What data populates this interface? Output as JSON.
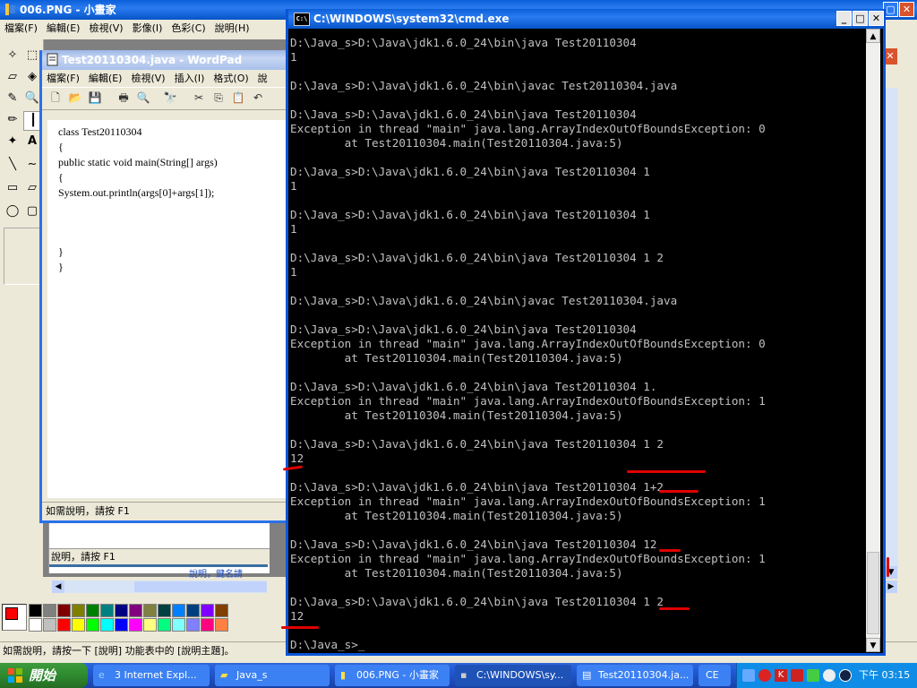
{
  "paint": {
    "title": "006.PNG - 小畫家",
    "menu": [
      "檔案(F)",
      "編輯(E)",
      "檢視(V)",
      "影像(I)",
      "色彩(C)",
      "說明(H)"
    ],
    "status": "如需說明，請按一下 [說明] 功能表中的 [說明主題]。",
    "palette_colors": [
      "#000000",
      "#808080",
      "#800000",
      "#808000",
      "#008000",
      "#008080",
      "#000080",
      "#800080",
      "#808040",
      "#004040",
      "#0080ff",
      "#004080",
      "#8000ff",
      "#804000",
      "#ffffff",
      "#c0c0c0",
      "#ff0000",
      "#ffff00",
      "#00ff00",
      "#00ffff",
      "#0000ff",
      "#ff00ff",
      "#ffff80",
      "#00ff80",
      "#80ffff",
      "#8080ff",
      "#ff0080",
      "#ff8040"
    ],
    "fg_color": "#ff0000"
  },
  "wordpad": {
    "title": "Test20110304.java - WordPad",
    "menu": [
      "檔案(F)",
      "編輯(E)",
      "檢視(V)",
      "插入(I)",
      "格式(O)",
      "說"
    ],
    "code": [
      "class Test20110304",
      "{",
      "public static void main(String[] args)",
      "{",
      "System.out.println(args[0]+args[1]);",
      "",
      "",
      "}",
      "}"
    ],
    "status": "如需說明，請按 F1",
    "behind_status": "說明，請按 F1",
    "behind_text": "說明，鍵名請"
  },
  "cmd": {
    "title": "C:\\WINDOWS\\system32\\cmd.exe",
    "lines": [
      "D:\\Java_s>D:\\Java\\jdk1.6.0_24\\bin\\java Test20110304",
      "1",
      "",
      "D:\\Java_s>D:\\Java\\jdk1.6.0_24\\bin\\javac Test20110304.java",
      "",
      "D:\\Java_s>D:\\Java\\jdk1.6.0_24\\bin\\java Test20110304",
      "Exception in thread \"main\" java.lang.ArrayIndexOutOfBoundsException: 0",
      "        at Test20110304.main(Test20110304.java:5)",
      "",
      "D:\\Java_s>D:\\Java\\jdk1.6.0_24\\bin\\java Test20110304 1",
      "1",
      "",
      "D:\\Java_s>D:\\Java\\jdk1.6.0_24\\bin\\java Test20110304 1",
      "1",
      "",
      "D:\\Java_s>D:\\Java\\jdk1.6.0_24\\bin\\java Test20110304 1 2",
      "1",
      "",
      "D:\\Java_s>D:\\Java\\jdk1.6.0_24\\bin\\javac Test20110304.java",
      "",
      "D:\\Java_s>D:\\Java\\jdk1.6.0_24\\bin\\java Test20110304",
      "Exception in thread \"main\" java.lang.ArrayIndexOutOfBoundsException: 0",
      "        at Test20110304.main(Test20110304.java:5)",
      "",
      "D:\\Java_s>D:\\Java\\jdk1.6.0_24\\bin\\java Test20110304 1.",
      "Exception in thread \"main\" java.lang.ArrayIndexOutOfBoundsException: 1",
      "        at Test20110304.main(Test20110304.java:5)",
      "",
      "D:\\Java_s>D:\\Java\\jdk1.6.0_24\\bin\\java Test20110304 1 2",
      "12",
      "",
      "D:\\Java_s>D:\\Java\\jdk1.6.0_24\\bin\\java Test20110304 1+2",
      "Exception in thread \"main\" java.lang.ArrayIndexOutOfBoundsException: 1",
      "        at Test20110304.main(Test20110304.java:5)",
      "",
      "D:\\Java_s>D:\\Java\\jdk1.6.0_24\\bin\\java Test20110304 12",
      "Exception in thread \"main\" java.lang.ArrayIndexOutOfBoundsException: 1",
      "        at Test20110304.main(Test20110304.java:5)",
      "",
      "D:\\Java_s>D:\\Java\\jdk1.6.0_24\\bin\\java Test20110304 1 2",
      "12",
      "",
      "D:\\Java_s>_"
    ]
  },
  "taskbar": {
    "start_label": "開始",
    "tasks": [
      "3 Internet Expl...",
      "Java_s",
      "006.PNG - 小畫家",
      "C:\\WINDOWS\\sy...",
      "Test20110304.ja...",
      "CE"
    ],
    "clock": "下午 03:15"
  }
}
